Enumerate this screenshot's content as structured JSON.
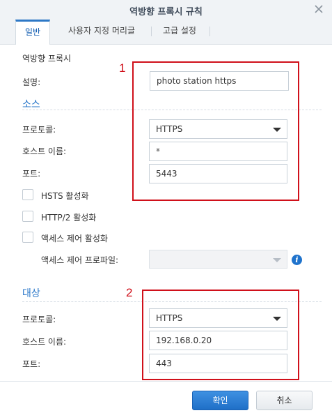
{
  "dialog": {
    "title": "역방향 프록시 규칙"
  },
  "tabs": [
    {
      "label": "일반"
    },
    {
      "label": "사용자 지정 머리글"
    },
    {
      "label": "고급 설정"
    }
  ],
  "general": {
    "rule_header": "역방향 프록시",
    "description_label": "설명:",
    "description_value": "photo station https"
  },
  "source": {
    "title": "소스",
    "protocol_label": "프로토콜:",
    "protocol_value": "HTTPS",
    "hostname_label": "호스트 이름:",
    "hostname_value": "*",
    "port_label": "포트:",
    "port_value": "5443",
    "hsts_label": "HSTS 활성화",
    "http2_label": "HTTP/2 활성화",
    "access_control_label": "액세스 제어 활성화",
    "access_profile_label": "액세스 제어 프로파일:",
    "access_profile_value": ""
  },
  "destination": {
    "title": "대상",
    "protocol_label": "프로토콜:",
    "protocol_value": "HTTPS",
    "hostname_label": "호스트 이름:",
    "hostname_value": "192.168.0.20",
    "port_label": "포트:",
    "port_value": "443"
  },
  "annotations": {
    "one": "1",
    "two": "2",
    "color": "#d0101a"
  },
  "footer": {
    "ok_label": "확인",
    "cancel_label": "취소"
  },
  "icons": {
    "close": "close-icon",
    "info": "info-icon",
    "dropdown": "chevron-down-icon"
  },
  "colors": {
    "accent": "#2a77c9",
    "primary_button": "#1f6fc7"
  }
}
